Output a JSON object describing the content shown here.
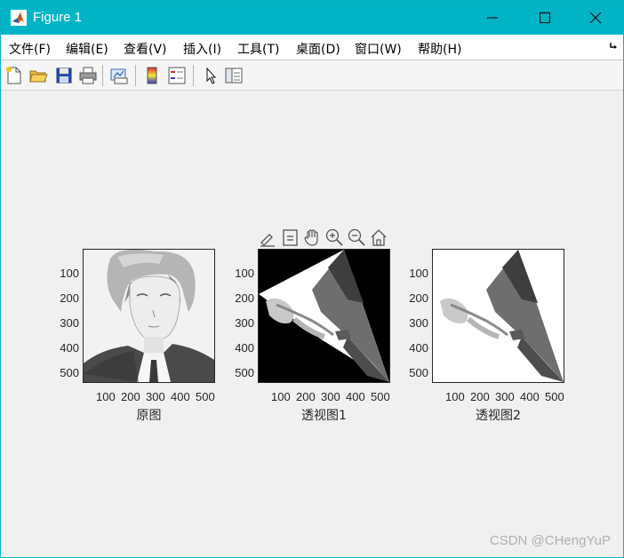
{
  "window": {
    "title": "Figure 1",
    "titlebar_color": "#00b4c6"
  },
  "menu": {
    "items": [
      "文件(F)",
      "编辑(E)",
      "查看(V)",
      "插入(I)",
      "工具(T)",
      "桌面(D)",
      "窗口(W)",
      "帮助(H)"
    ]
  },
  "toolbar": {
    "icons": [
      "new-figure-icon",
      "open-file-icon",
      "save-icon",
      "print-icon",
      "link-plot-icon",
      "insert-colorbar-icon",
      "insert-legend-icon",
      "edit-plot-arrow-icon",
      "property-inspector-icon"
    ]
  },
  "axes_toolbar": {
    "icons": [
      "brush-icon",
      "data-tips-icon",
      "pan-hand-icon",
      "zoom-in-icon",
      "zoom-out-icon",
      "home-restore-icon"
    ]
  },
  "plots": [
    {
      "xlabel": "原图",
      "yticks": [
        "100",
        "200",
        "300",
        "400",
        "500"
      ],
      "xticks": [
        "100",
        "200",
        "300",
        "400",
        "500"
      ]
    },
    {
      "xlabel": "透视图1",
      "yticks": [
        "100",
        "200",
        "300",
        "400",
        "500"
      ],
      "xticks": [
        "100",
        "200",
        "300",
        "400",
        "500"
      ]
    },
    {
      "xlabel": "透视图2",
      "yticks": [
        "100",
        "200",
        "300",
        "400",
        "500"
      ],
      "xticks": [
        "100",
        "200",
        "300",
        "400",
        "500"
      ]
    }
  ],
  "watermark": "CSDN @CHengYuP"
}
